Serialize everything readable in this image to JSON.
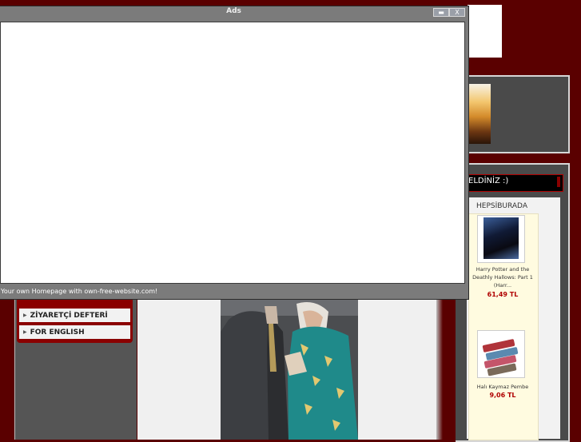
{
  "popup": {
    "title": "Ads",
    "footer_text": "Your own Homepage with own-free-website.com!",
    "minimize_icon": "minimize-icon",
    "close_label": "X"
  },
  "welcome_text": "ELDİNİZ :)",
  "shop": {
    "title": "HEPSİBURADA",
    "products": [
      {
        "name": "Harry Potter and the Deathly Hallows: Part 1 (Harr...",
        "price": "61,49 TL"
      },
      {
        "name": "Halı Kaymaz Pembe",
        "price": "9,06 TL"
      }
    ]
  },
  "menu": {
    "items": [
      {
        "label": "ZİYARETÇİ DEFTERİ"
      },
      {
        "label": "FOR ENGLISH"
      }
    ]
  },
  "colors": {
    "background": "#5a0000",
    "accent_red": "#8a0000",
    "price_red": "#b00000",
    "popup_frame": "#7b7b7b"
  }
}
